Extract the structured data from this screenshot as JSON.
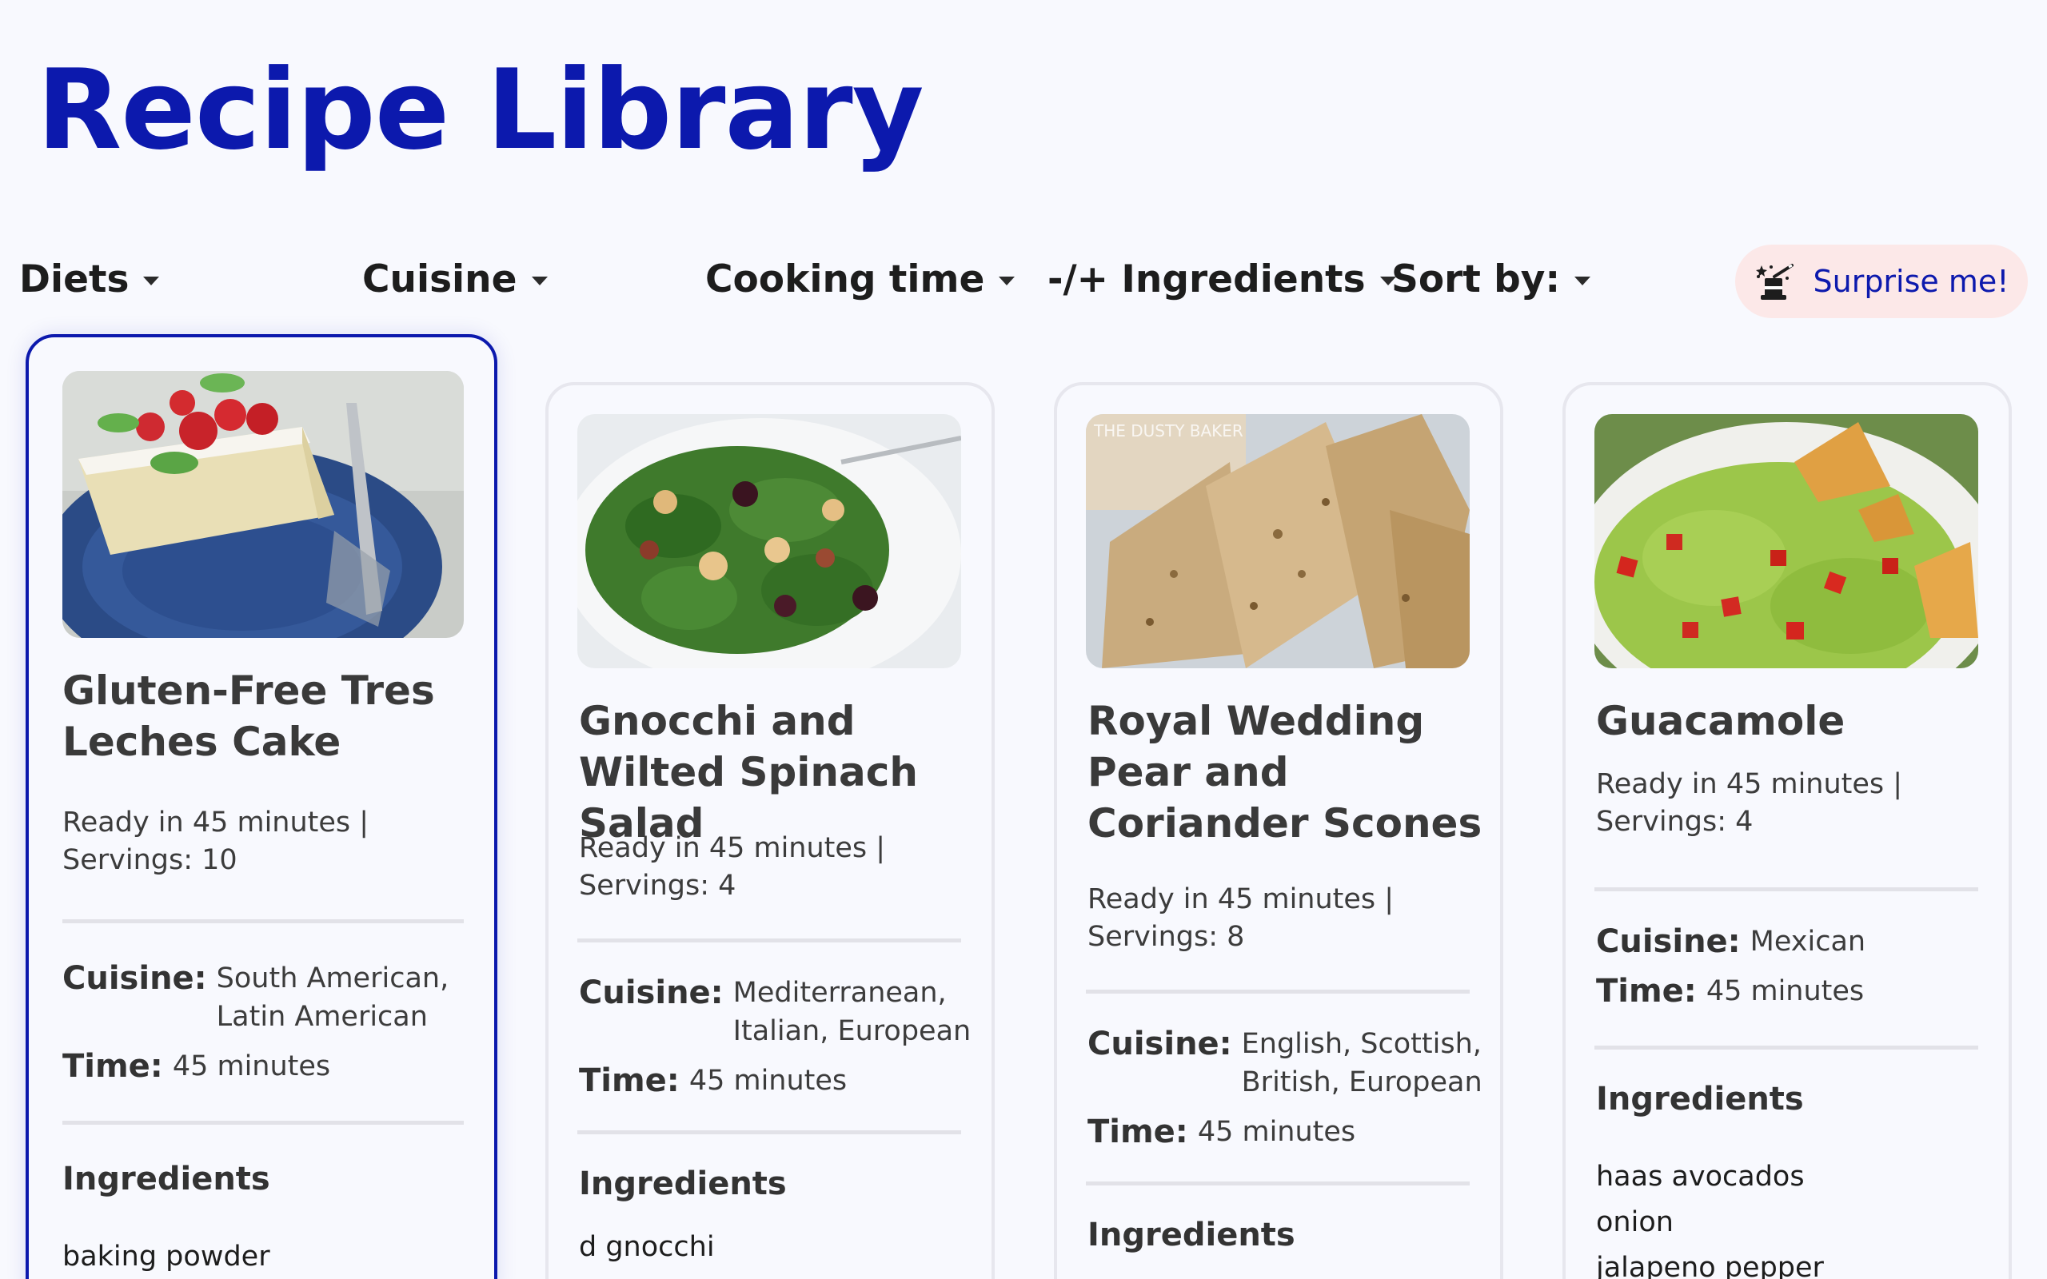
{
  "app": {
    "title": "Recipe Library"
  },
  "filters": {
    "diets": "Diets",
    "cuisine": "Cuisine",
    "cooking_time": "Cooking time",
    "ingredients": "-/+ Ingredients",
    "sort_by": "Sort by:"
  },
  "surprise": {
    "label": "Surprise me!",
    "icon": "magic-hat-icon"
  },
  "labels": {
    "cuisine": "Cuisine:",
    "time": "Time:",
    "ingredients": "Ingredients"
  },
  "colors": {
    "accent": "#0c19ad",
    "surprise_bg": "#fce8e8",
    "background": "#f8f9fe"
  },
  "recipes": [
    {
      "title": "Gluten-Free Tres Leches Cake",
      "ready": "Ready in 45 minutes |",
      "servings": "Servings: 10",
      "cuisine": "South American, Latin American",
      "time": "45 minutes",
      "ingredients": [
        "baking powder"
      ],
      "selected": true
    },
    {
      "title": "Gnocchi and Wilted Spinach Salad",
      "ready": "Ready in 45 minutes |",
      "servings": "Servings: 4",
      "cuisine": "Mediterranean, Italian, European",
      "time": "45 minutes",
      "ingredients": [
        "d gnocchi"
      ]
    },
    {
      "title": "Royal Wedding Pear and Coriander Scones",
      "ready": "Ready in 45 minutes |",
      "servings": "Servings: 8",
      "cuisine": "English, Scottish, British, European",
      "time": "45 minutes",
      "ingredients": [],
      "photo_watermark": "THE DUSTY BAKER"
    },
    {
      "title": "Guacamole",
      "ready": "Ready in 45 minutes |",
      "servings": "Servings: 4",
      "cuisine": "Mexican",
      "time": "45 minutes",
      "ingredients": [
        "haas avocados",
        "onion",
        "jalapeno pepper"
      ]
    }
  ]
}
